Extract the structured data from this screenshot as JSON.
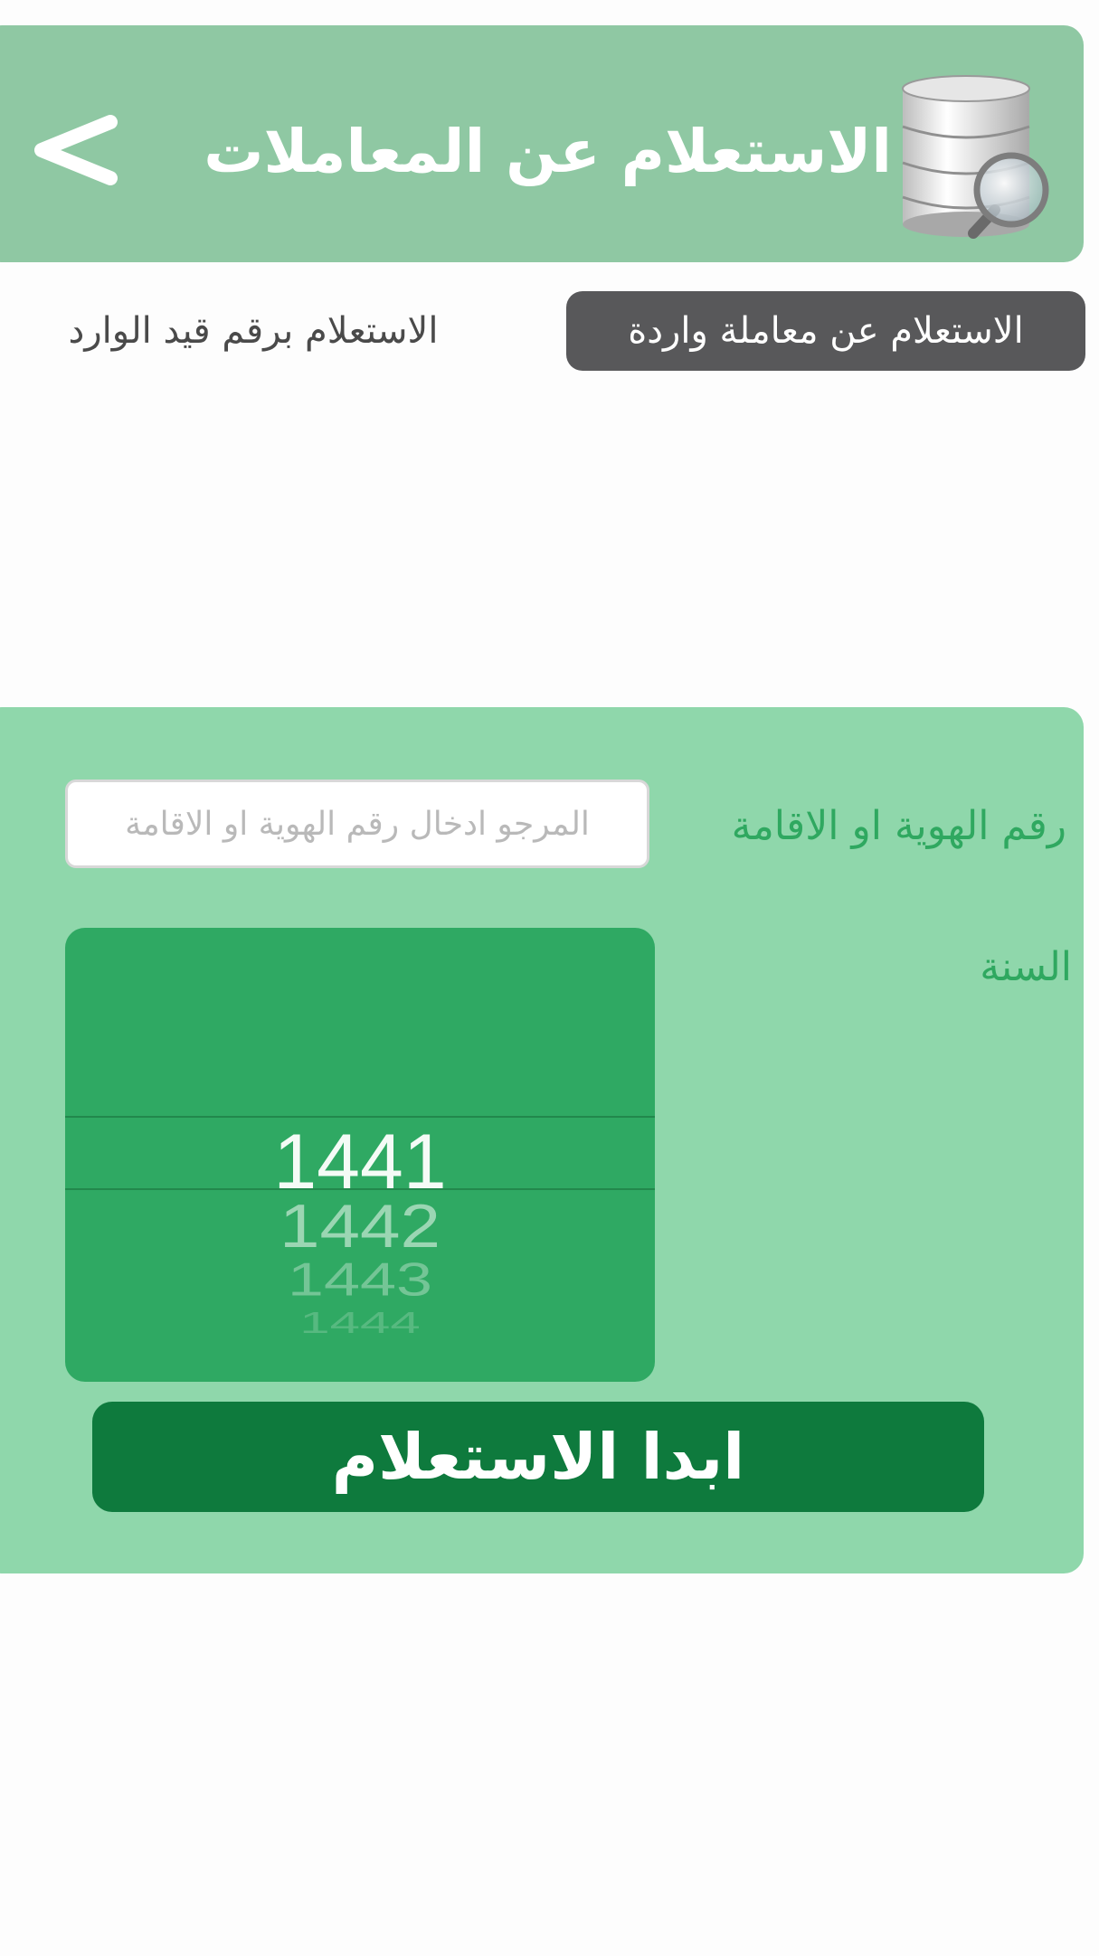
{
  "header": {
    "title": "الاستعلام عن المعاملات",
    "back_icon": "chevron-left-icon",
    "logo_icon": "database-search-icon",
    "color": "#8fc8a3"
  },
  "tabs": [
    {
      "label": "الاستعلام عن معاملة واردة",
      "selected": true
    },
    {
      "label": "الاستعلام برقم قيد الوارد",
      "selected": false
    }
  ],
  "form": {
    "id_label": "رقم الهوية او الاقامة",
    "id_value": "",
    "id_placeholder": "المرجو ادخال رقم الهوية او الاقامة",
    "year_label": "السنة",
    "year_options": [
      "1441",
      "1442",
      "1443",
      "1444"
    ],
    "year_selected": "1441",
    "submit_label": "ابدا الاستعلام"
  },
  "colors": {
    "panel": "#8fd7ab",
    "picker": "#2fa963",
    "submit": "#0e7a3d",
    "label": "#2fa860",
    "tab_active": "#58585a"
  }
}
